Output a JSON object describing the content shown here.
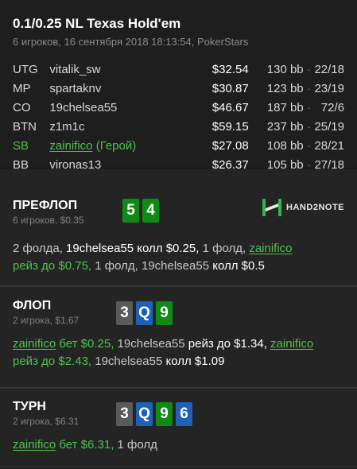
{
  "header": {
    "title": "0.1/0.25 NL Texas Hold'em",
    "subtitle": "6 игроков, 16 сентября 2018 18:13:54, PokerStars"
  },
  "players": [
    {
      "pos": "UTG",
      "name": "vitalik_sw",
      "stack": "$32.54",
      "bb": "130 bb",
      "sep": "·",
      "ratio": "22/18"
    },
    {
      "pos": "MP",
      "name": "spartaknv",
      "stack": "$30.87",
      "bb": "123 bb",
      "sep": "·",
      "ratio": "23/19"
    },
    {
      "pos": "CO",
      "name": "19chelsea55",
      "stack": "$46.67",
      "bb": "187 bb",
      "sep": "·",
      "ratio": "72/6"
    },
    {
      "pos": "BTN",
      "name": "z1m1c",
      "stack": "$59.15",
      "bb": "237 bb",
      "sep": "·",
      "ratio": "25/19"
    },
    {
      "pos": "SB",
      "name": "zainifico",
      "hero_tag": " (Герой)",
      "stack": "$27.08",
      "bb": "108 bb",
      "sep": "·",
      "ratio": "28/21"
    },
    {
      "pos": "BB",
      "name": "vironas13",
      "stack": "$26.37",
      "bb": "105 bb",
      "sep": "·",
      "ratio": "27/18"
    }
  ],
  "logo": {
    "text": "HAND2NOTE"
  },
  "streets": {
    "preflop": {
      "name": "ПРЕФЛОП",
      "meta": "6 игроков, $0.35",
      "cards": [
        "5",
        "4"
      ],
      "a1": "2 фолда, ",
      "a2": "19chelsea55",
      "a3": " колл $0.25, ",
      "a4": "1 фолд, ",
      "a5": "zainifico",
      "a6": "рейз до $0.75, ",
      "a7": "1 фолд, ",
      "a8": "19chelsea55",
      "a9": " колл $0.5"
    },
    "flop": {
      "name": "ФЛОП",
      "meta": "2 игрока, $1.67",
      "cards": [
        "3",
        "Q",
        "9"
      ],
      "a1": "zainifico",
      "a2": " бет $0.25, ",
      "a3": "19chelsea55",
      "a4": " рейз до $1.34, ",
      "a5": "zainifico",
      "a6": "рейз до $2.43, ",
      "a7": "19chelsea55",
      "a8": " колл $1.09"
    },
    "turn": {
      "name": "ТУРН",
      "meta": "2 игрока, $6.31",
      "cards": [
        "3",
        "Q",
        "9",
        "6"
      ],
      "a1": "zainifico",
      "a2": " бет $6.31, ",
      "a3": "1 фолд"
    }
  },
  "colors": {
    "hero": "#4fc24f",
    "card_green": "#0f8a14",
    "card_blue": "#1d62b8",
    "card_gray": "#5a5a5a"
  }
}
